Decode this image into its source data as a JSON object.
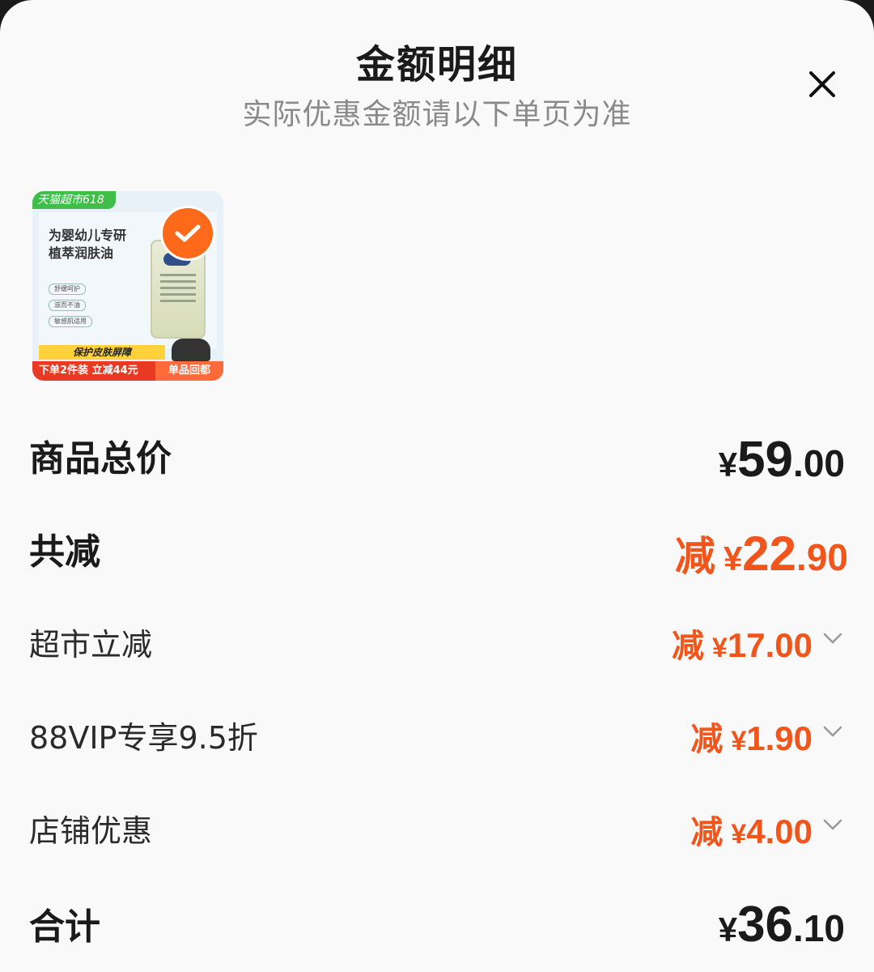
{
  "header": {
    "title": "金额明细",
    "subtitle": "实际优惠金额请以下单页为准"
  },
  "product": {
    "badge": "天猫超市618",
    "headline_line1": "为婴幼儿专研",
    "headline_line2": "植萃润肤油",
    "features": [
      "舒缓呵护",
      "滋而不油",
      "敏感肌适用"
    ],
    "banner": "保护皮肤屏障",
    "promo_left": "下单2件装 立减44元",
    "promo_right": "单品回都"
  },
  "summary": {
    "total": {
      "label": "商品总价",
      "currency": "¥",
      "int": "59",
      "dec": ".00"
    },
    "discount_total": {
      "label": "共减",
      "prefix": "减",
      "currency": "¥",
      "int": "22",
      "dec": ".90"
    },
    "items": [
      {
        "label": "超市立减",
        "prefix": "减",
        "currency": "¥",
        "amount": "17.00"
      },
      {
        "label": "88VIP专享9.5折",
        "prefix": "减",
        "currency": "¥",
        "amount": "1.90"
      },
      {
        "label": "店铺优惠",
        "prefix": "减",
        "currency": "¥",
        "amount": "4.00"
      }
    ],
    "grand_total": {
      "label": "合计",
      "currency": "¥",
      "int": "36",
      "dec": ".10"
    }
  },
  "colors": {
    "accent": "#f0561c",
    "check": "#ff6a1a",
    "text": "#1a1a1a",
    "muted": "#8a8a8a"
  }
}
